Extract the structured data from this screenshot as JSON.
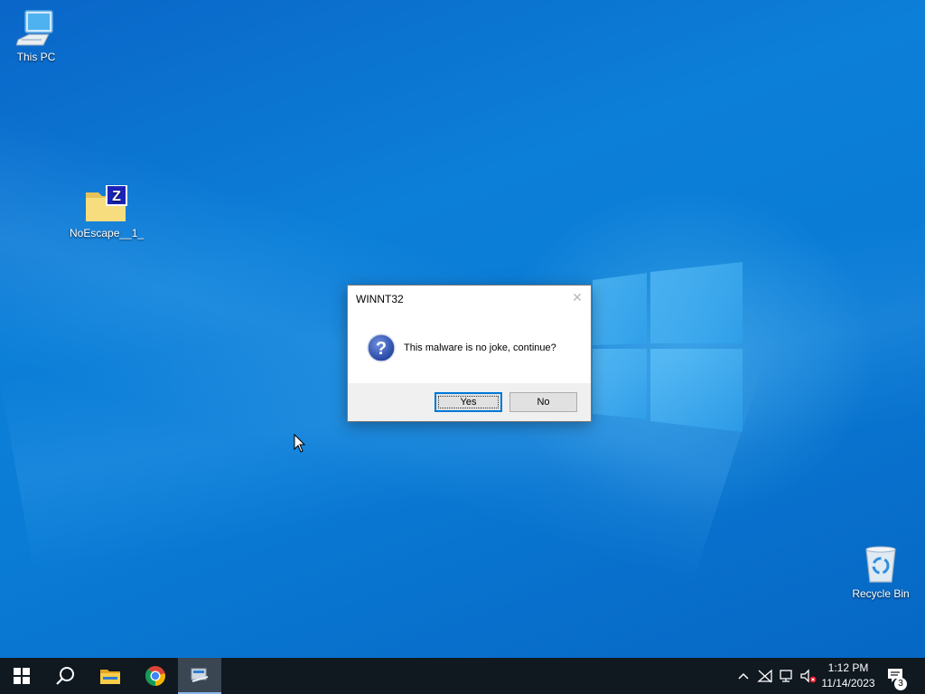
{
  "desktop": {
    "icons": [
      {
        "label": "This PC",
        "icon": "computer-icon"
      },
      {
        "label": "NoEscape__1_",
        "icon": "compressed-folder-icon"
      },
      {
        "label": "Recycle Bin",
        "icon": "recycle-bin-icon"
      }
    ]
  },
  "dialog": {
    "title": "WINNT32",
    "message": "This malware is no joke, continue?",
    "icon": "question-icon",
    "yes_label": "Yes",
    "no_label": "No"
  },
  "taskbar": {
    "pinned": [
      {
        "name": "start",
        "icon": "windows-start-icon"
      },
      {
        "name": "search",
        "icon": "search-icon"
      },
      {
        "name": "file-explorer",
        "icon": "file-explorer-icon"
      },
      {
        "name": "chrome",
        "icon": "chrome-icon"
      },
      {
        "name": "running-app",
        "icon": "setup-app-icon",
        "active": true
      }
    ],
    "tray": {
      "icons": [
        "chevron-up-icon",
        "network-offline-icon",
        "display-icon",
        "volume-muted-icon"
      ],
      "time": "1:12 PM",
      "date": "11/14/2023",
      "notification_count": "3"
    }
  },
  "colors": {
    "desktop_blue": "#0a7cd6",
    "taskbar": "#101820",
    "accent": "#0078d7"
  }
}
